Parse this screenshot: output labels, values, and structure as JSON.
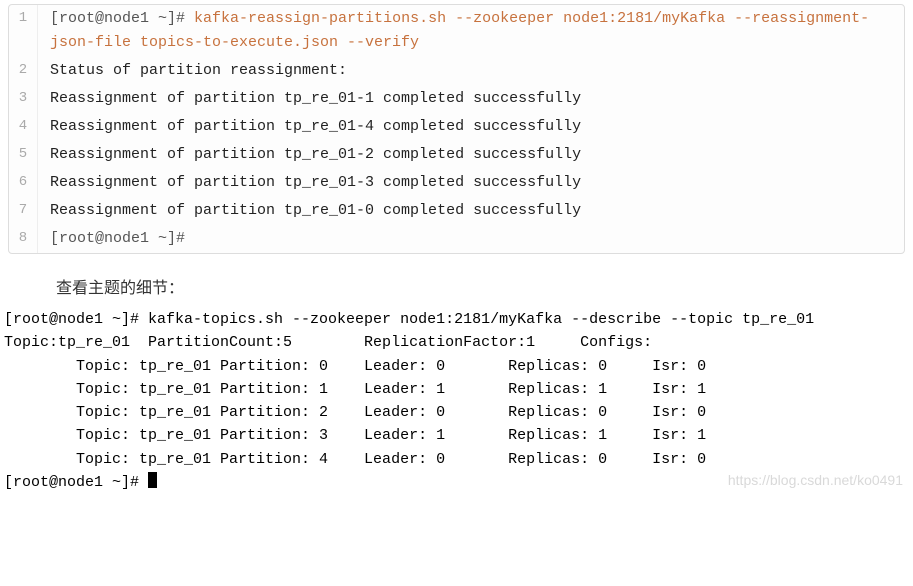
{
  "code_block": {
    "lines": [
      {
        "n": "1",
        "prompt": "[root@node1 ~]#",
        "cmd": " kafka-reassign-partitions.sh --zookeeper node1:2181/myKafka --reassignment-json-file topics-to-execute.json --verify"
      },
      {
        "n": "2",
        "plain": "Status of partition reassignment:"
      },
      {
        "n": "3",
        "plain": "Reassignment of partition tp_re_01-1 completed successfully"
      },
      {
        "n": "4",
        "plain": "Reassignment of partition tp_re_01-4 completed successfully"
      },
      {
        "n": "5",
        "plain": "Reassignment of partition tp_re_01-2 completed successfully"
      },
      {
        "n": "6",
        "plain": "Reassignment of partition tp_re_01-3 completed successfully"
      },
      {
        "n": "7",
        "plain": "Reassignment of partition tp_re_01-0 completed successfully"
      },
      {
        "n": "8",
        "prompt": "[root@node1 ~]#",
        "cmd": ""
      }
    ]
  },
  "caption": "查看主题的细节：",
  "terminal": {
    "cmd_line": "[root@node1 ~]# kafka-topics.sh --zookeeper node1:2181/myKafka --describe --topic tp_re_01",
    "header": "Topic:tp_re_01  PartitionCount:5        ReplicationFactor:1     Configs:",
    "rows": [
      "        Topic: tp_re_01 Partition: 0    Leader: 0       Replicas: 0     Isr: 0",
      "        Topic: tp_re_01 Partition: 1    Leader: 1       Replicas: 1     Isr: 1",
      "        Topic: tp_re_01 Partition: 2    Leader: 0       Replicas: 0     Isr: 0",
      "        Topic: tp_re_01 Partition: 3    Leader: 1       Replicas: 1     Isr: 1",
      "        Topic: tp_re_01 Partition: 4    Leader: 0       Replicas: 0     Isr: 0"
    ],
    "final_prompt": "[root@node1 ~]# "
  },
  "watermark": "https://blog.csdn.net/ko0491",
  "chart_data": {
    "type": "table",
    "title": "kafka-topics.sh --describe output",
    "columns": [
      "Topic",
      "Partition",
      "Leader",
      "Replicas",
      "Isr"
    ],
    "rows": [
      [
        "tp_re_01",
        0,
        0,
        0,
        0
      ],
      [
        "tp_re_01",
        1,
        1,
        1,
        1
      ],
      [
        "tp_re_01",
        2,
        0,
        0,
        0
      ],
      [
        "tp_re_01",
        3,
        1,
        1,
        1
      ],
      [
        "tp_re_01",
        4,
        0,
        0,
        0
      ]
    ],
    "summary": {
      "Topic": "tp_re_01",
      "PartitionCount": 5,
      "ReplicationFactor": 1,
      "Configs": ""
    }
  }
}
